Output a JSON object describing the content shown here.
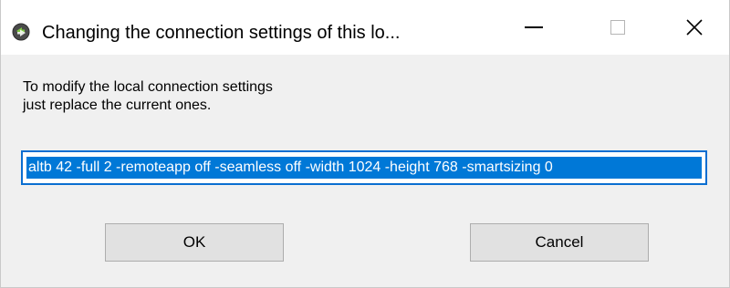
{
  "window": {
    "title": "Changing the connection settings of this lo...",
    "app_icon": "arrows-connection-icon",
    "accent_color": "#0078d7"
  },
  "caption_buttons": {
    "minimize_icon": "minimize-icon",
    "maximize_icon": "maximize-icon",
    "close_icon": "close-icon"
  },
  "dialog": {
    "message_line1": "To modify the local connection settings",
    "message_line2": "just replace the current ones.",
    "settings_value": "altb 42 -full 2 -remoteapp off -seamless off -width 1024 -height 768 -smartsizing 0",
    "ok_label": "OK",
    "cancel_label": "Cancel"
  }
}
